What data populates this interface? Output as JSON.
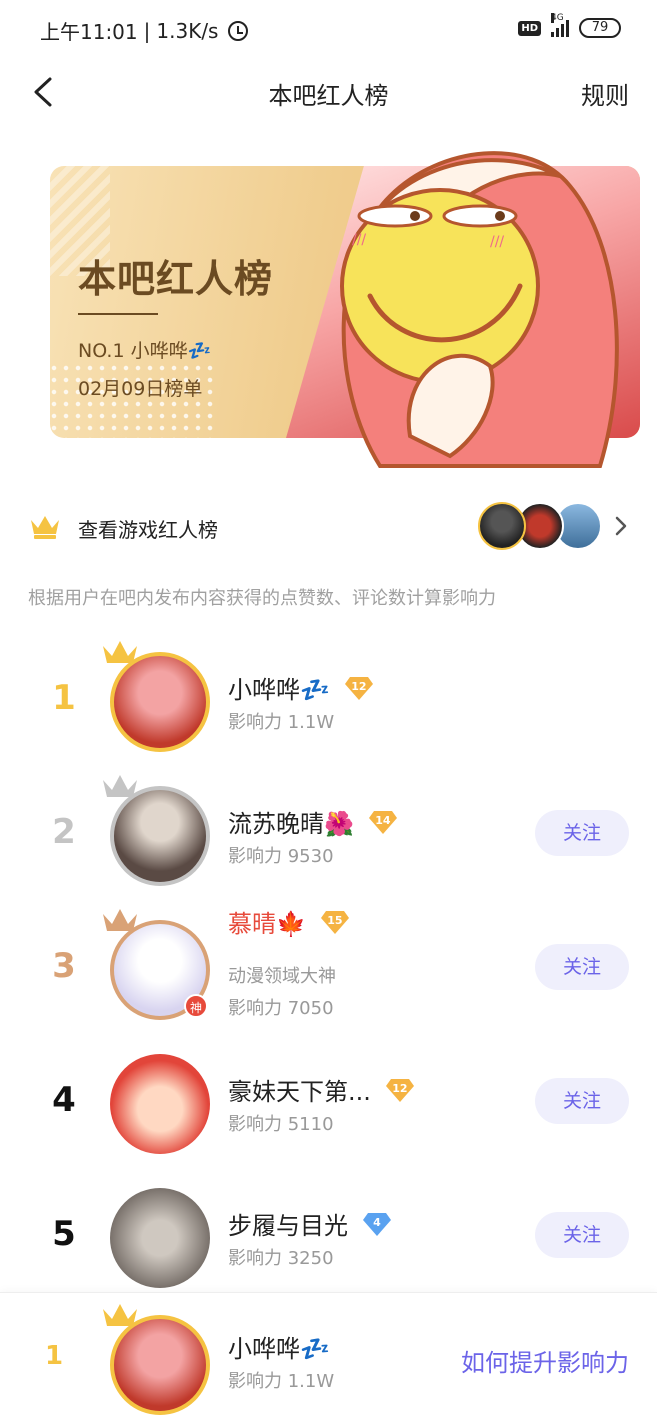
{
  "status_bar": {
    "time": "上午11:01",
    "speed": "1.3K/s",
    "hd": "HD",
    "network": "4G",
    "battery": "79"
  },
  "header": {
    "title": "本吧红人榜",
    "rules": "规则"
  },
  "banner": {
    "title": "本吧红人榜",
    "no1_label": "NO.1",
    "no1_name": "小哗哗💤",
    "date": "02月09日榜单"
  },
  "game_list": {
    "label": "查看游戏红人榜"
  },
  "description": "根据用户在吧内发布内容获得的点赞数、评论数计算影响力",
  "rankings": [
    {
      "rank": "1",
      "name": "小哗哗💤",
      "level": "12",
      "title": "",
      "influence": "影响力 1.1W",
      "follow": ""
    },
    {
      "rank": "2",
      "name": "流苏晚晴🌺",
      "level": "14",
      "title": "",
      "influence": "影响力 9530",
      "follow": "关注"
    },
    {
      "rank": "3",
      "name": "慕晴🍁",
      "level": "15",
      "title": "动漫领域大神",
      "influence": "影响力 7050",
      "follow": "关注"
    },
    {
      "rank": "4",
      "name": "豪妹天下第...",
      "level": "12",
      "title": "",
      "influence": "影响力 5110",
      "follow": "关注"
    },
    {
      "rank": "5",
      "name": "步履与目光",
      "level": "4",
      "title": "",
      "influence": "影响力 3250",
      "follow": "关注"
    }
  ],
  "me": {
    "rank": "1",
    "name": "小哗哗💤",
    "influence": "影响力 1.1W",
    "improve_link": "如何提升影响力"
  },
  "colors": {
    "accent": "#6b63e8",
    "gold": "#f5c342",
    "silver": "#c4c4c4",
    "bronze": "#d9a276",
    "red_name": "#e74a3b"
  }
}
